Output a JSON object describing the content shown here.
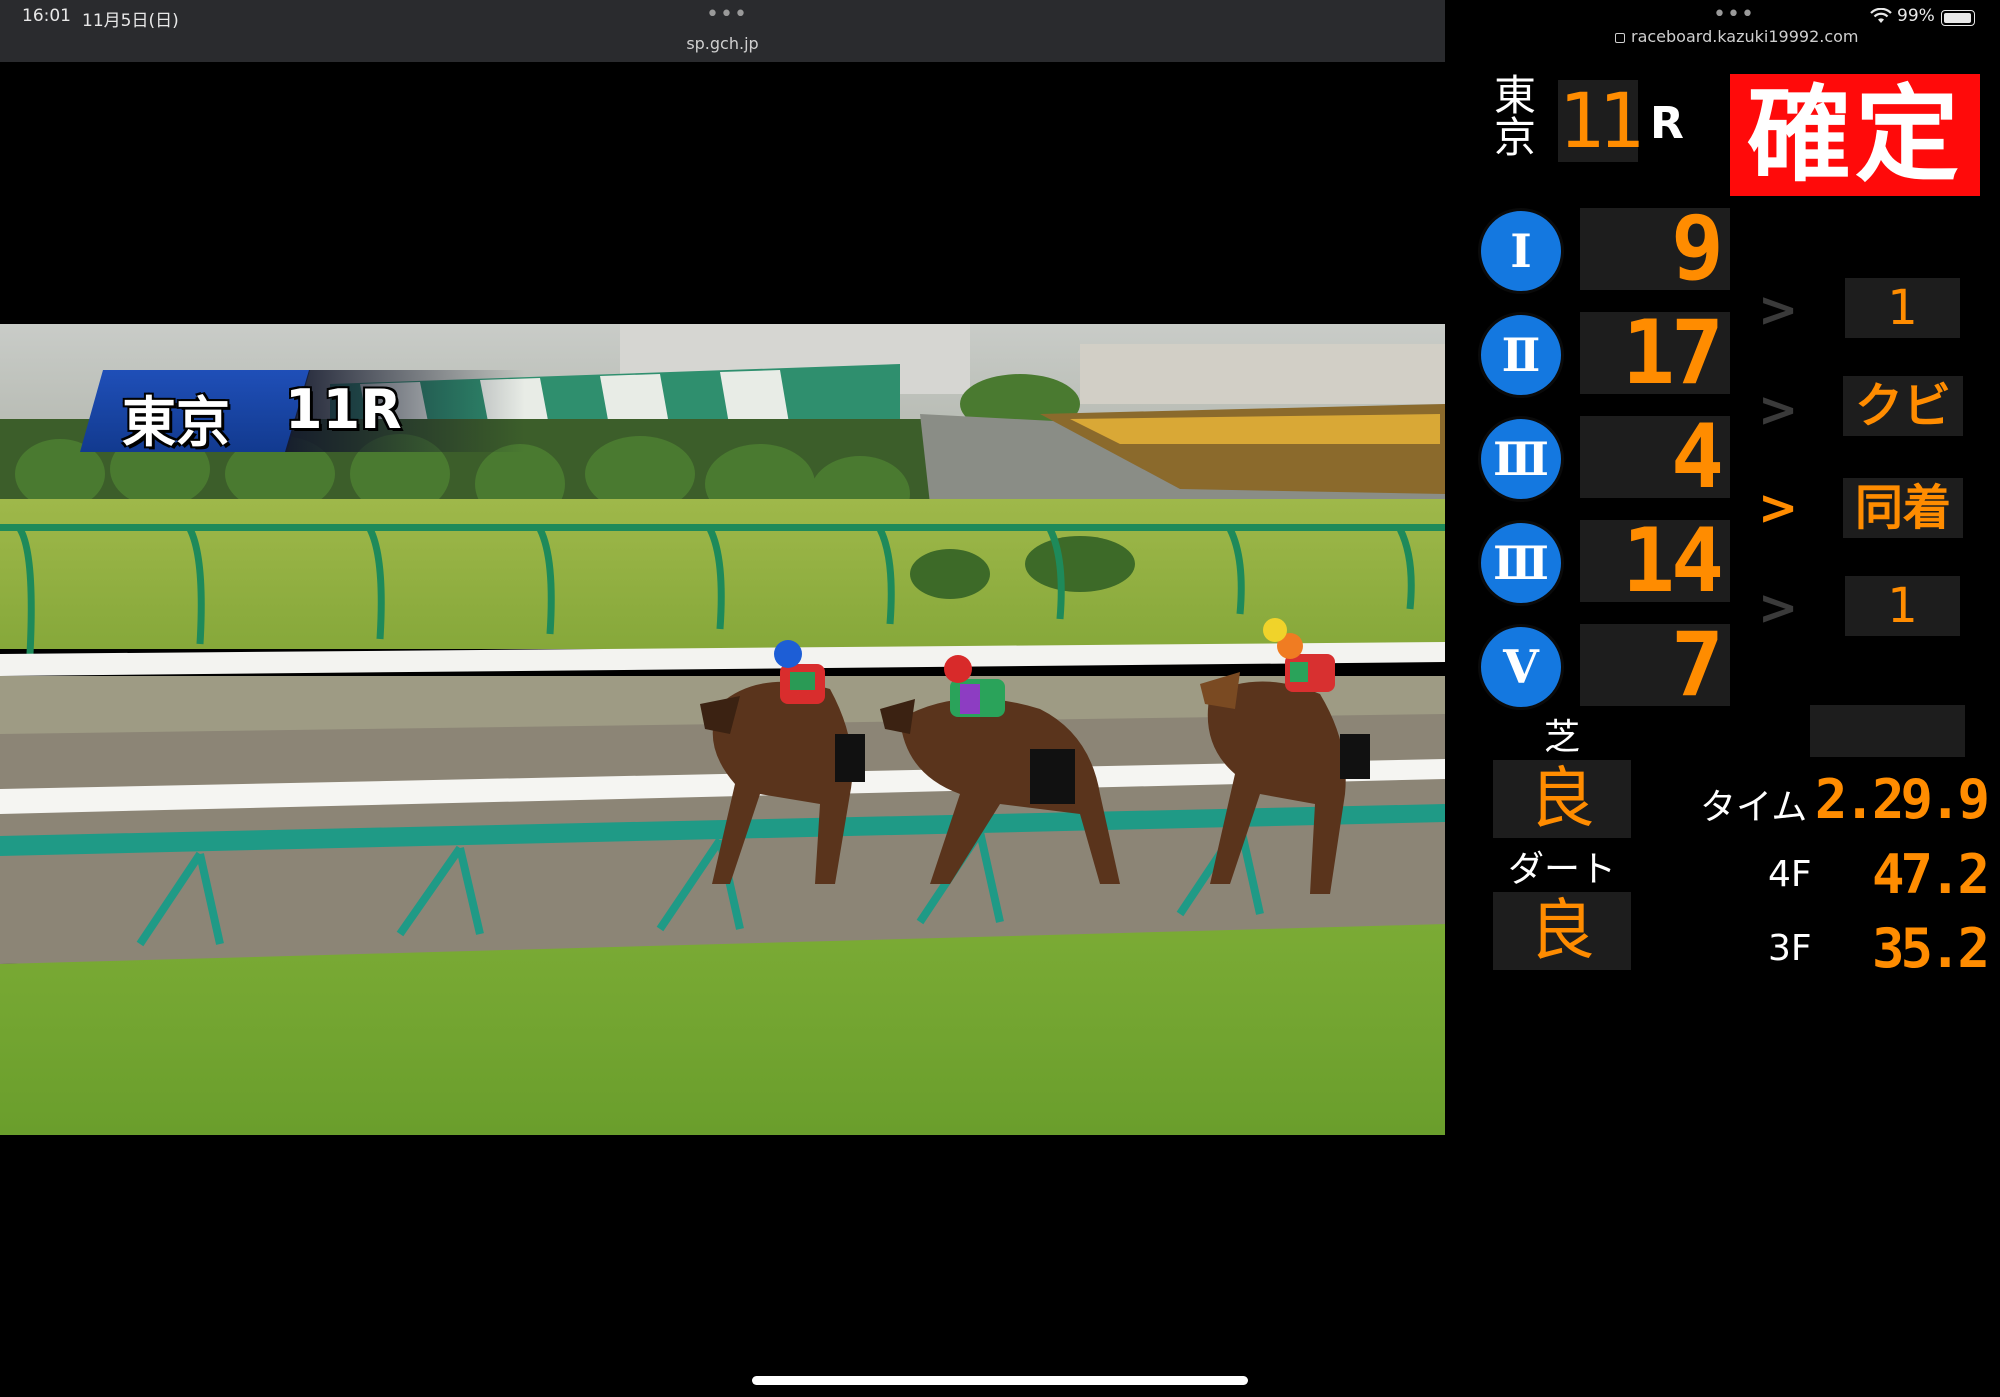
{
  "left_status": {
    "time": "16:01",
    "date": "11月5日(日)",
    "dots": "•••",
    "url": "sp.gch.jp"
  },
  "video_overlay": {
    "track": "東京",
    "race": "11R"
  },
  "right_status": {
    "dots": "•••",
    "url": "raceboard.kazuki19992.com",
    "battery": "99%"
  },
  "board": {
    "track": "東京",
    "race_number": "11",
    "race_suffix": "R",
    "status": "確定",
    "places": [
      {
        "rank": "Ⅰ",
        "horse": "9"
      },
      {
        "rank": "Ⅱ",
        "horse": "17"
      },
      {
        "rank": "Ⅲ",
        "horse": "4"
      },
      {
        "rank": "Ⅲ",
        "horse": "14"
      },
      {
        "rank": "Ⅴ",
        "horse": "7"
      }
    ],
    "margins": [
      {
        "arrow": ">",
        "value": "1",
        "lit": false
      },
      {
        "arrow": ">",
        "value": "クビ",
        "lit": false
      },
      {
        "arrow": ">",
        "value": "同着",
        "lit": true
      },
      {
        "arrow": ">",
        "value": "1",
        "lit": false
      }
    ],
    "turf_label": "芝",
    "turf_condition": "良",
    "dirt_label": "ダート",
    "dirt_condition": "良",
    "time_label": "タイム",
    "time_value": "2.29.9",
    "f4_label": "4F",
    "f4_value": "47.2",
    "f3_label": "3F",
    "f3_value": "35.2"
  },
  "colors": {
    "led_orange": "#ff8c00",
    "status_red": "#ff0a0a",
    "rank_blue": "#1478e0"
  }
}
